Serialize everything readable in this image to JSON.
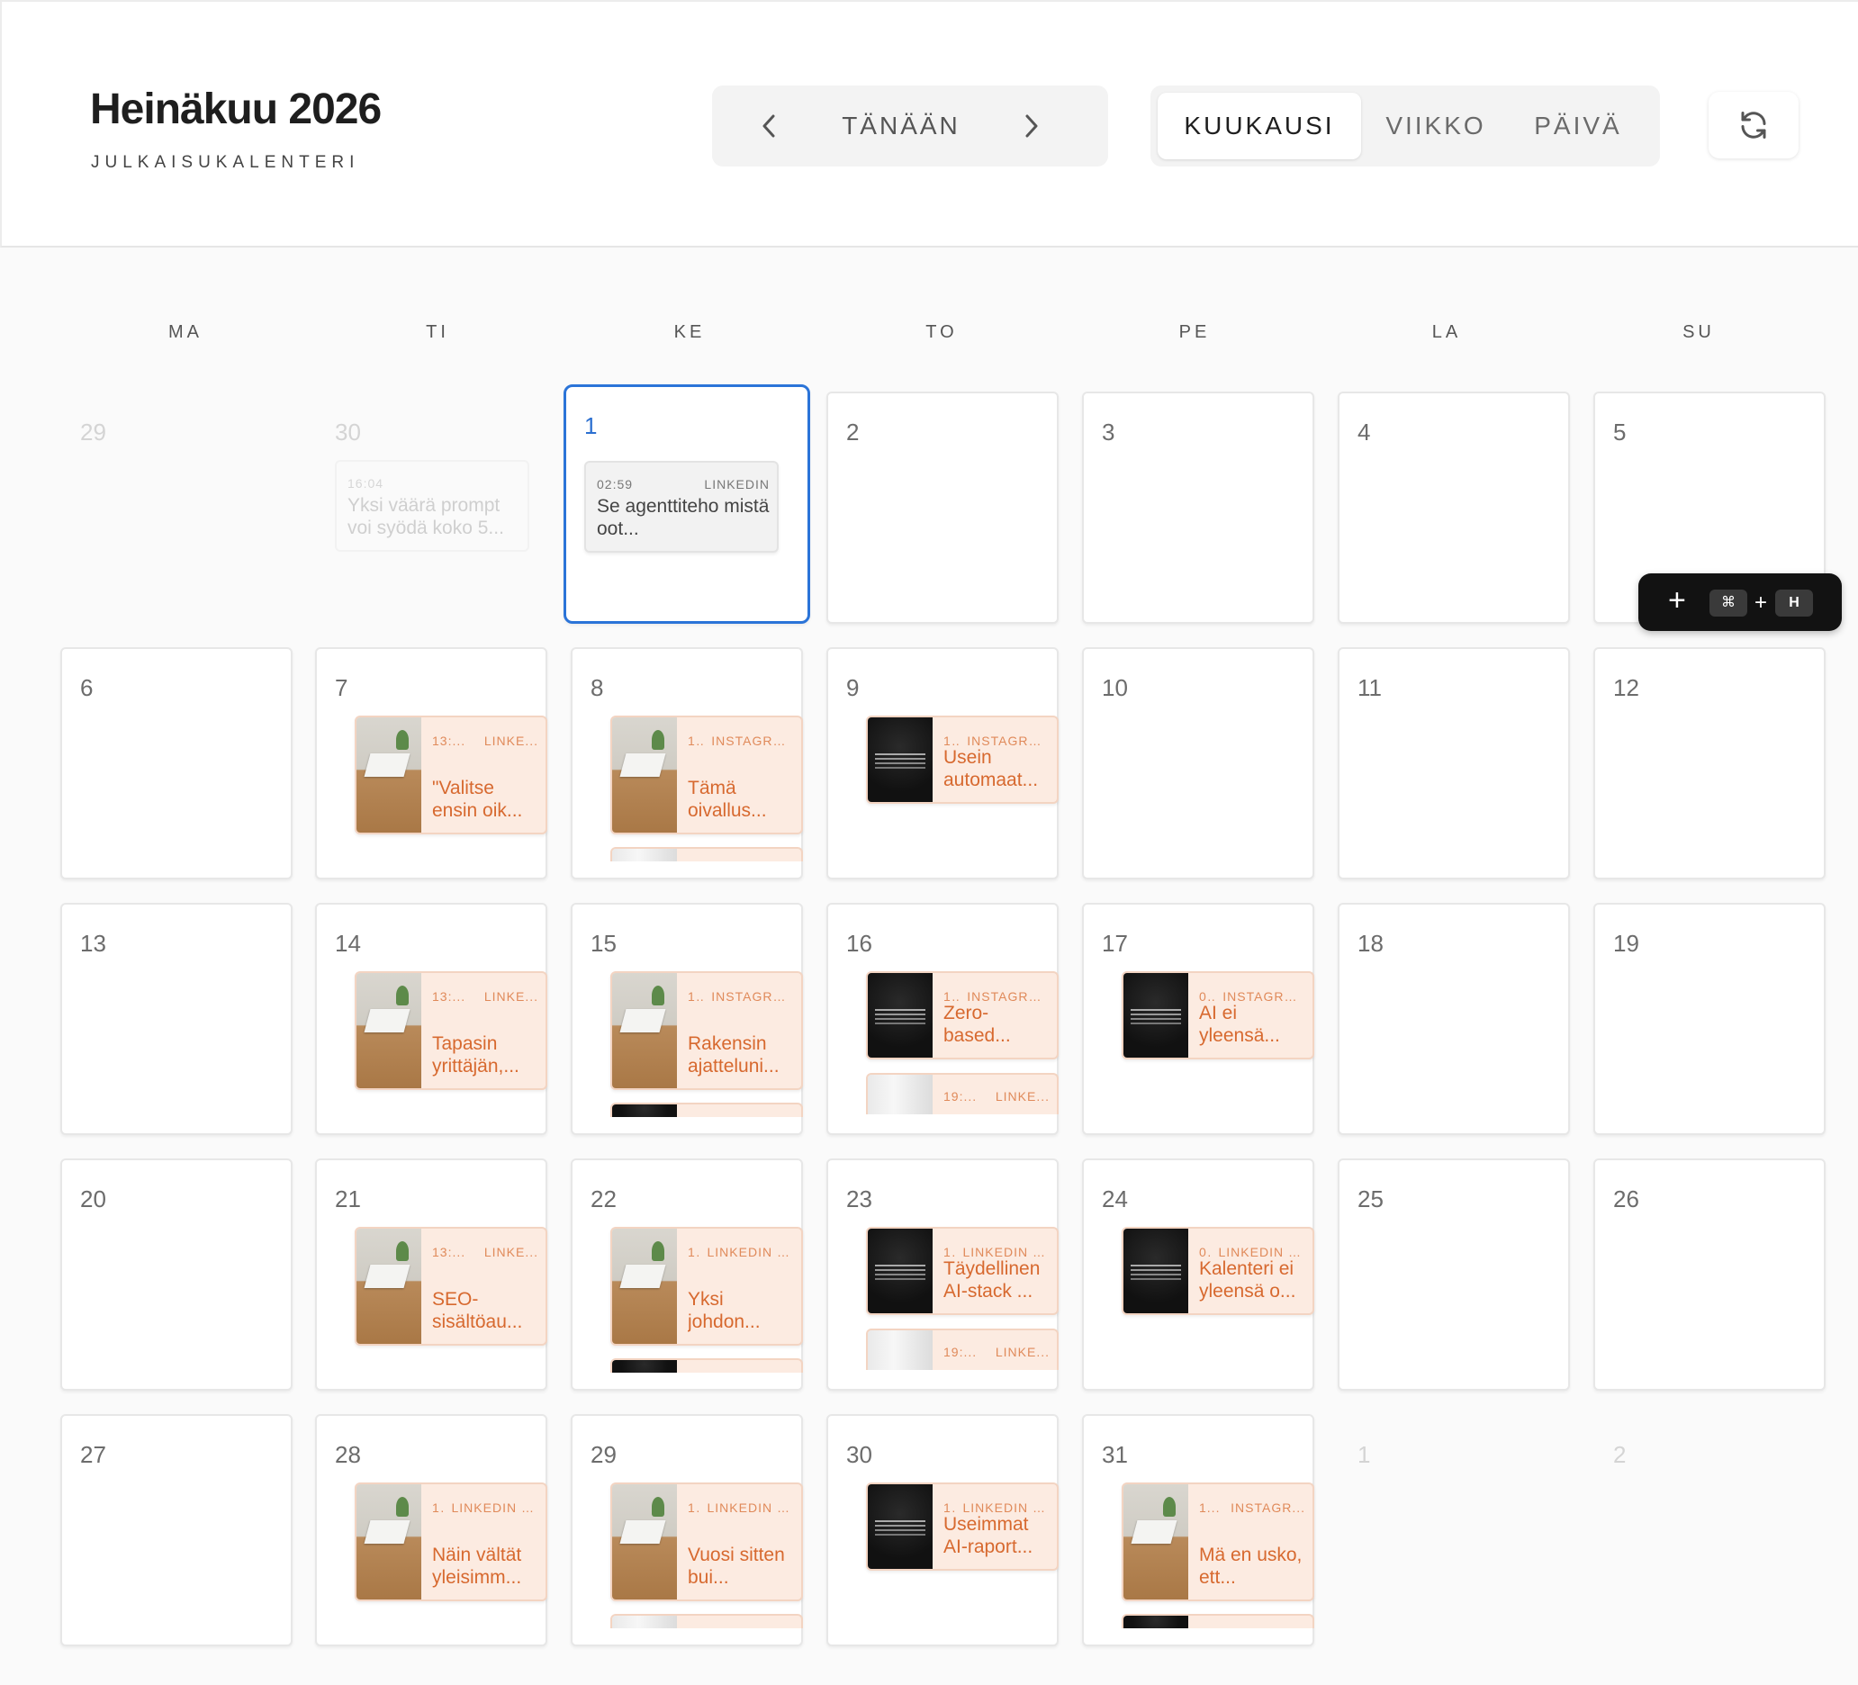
{
  "header": {
    "title": "Heinäkuu 2026",
    "subtitle": "JULKAISUKALENTERI",
    "today_label": "TÄNÄÄN",
    "prev_icon": "chevron-left-icon",
    "next_icon": "chevron-right-icon",
    "refresh_icon": "refresh-icon"
  },
  "views": {
    "month": "KUUKAUSI",
    "week": "VIIKKO",
    "day": "PÄIVÄ",
    "active": "month"
  },
  "weekdays": [
    "MA",
    "TI",
    "KE",
    "TO",
    "PE",
    "LA",
    "SU"
  ],
  "colors": {
    "accent": "#2b74d8",
    "event_bg": "#fcebe1",
    "event_text": "#d7692f",
    "event_meta": "#e08a5a"
  },
  "weeks": [
    [
      {
        "day": "29",
        "muted": true,
        "events": []
      },
      {
        "day": "30",
        "muted": true,
        "events": [
          {
            "time": "16:04",
            "network": "",
            "title": "Yksi väärä prompt voi syödä koko 5...",
            "style": "faded"
          }
        ]
      },
      {
        "day": "1",
        "today": true,
        "events": [
          {
            "time": "02:59",
            "network": "LINKEDIN",
            "title": "Se agenttiteho mistä oot...",
            "style": "grey"
          }
        ]
      },
      {
        "day": "2",
        "events": []
      },
      {
        "day": "3",
        "events": []
      },
      {
        "day": "4",
        "events": []
      },
      {
        "day": "5",
        "events": []
      }
    ],
    [
      {
        "day": "6",
        "events": []
      },
      {
        "day": "7",
        "events": [
          {
            "time": "13:...",
            "network": "LINKE...",
            "title": "\"Valitse ensin oik...",
            "thumb": "desk"
          }
        ]
      },
      {
        "day": "8",
        "events": [
          {
            "time": "1..",
            "network": "INSTAGRA...",
            "title": "Tämä oivallus...",
            "thumb": "desk"
          },
          {
            "style": "stub",
            "thumb": "light"
          }
        ]
      },
      {
        "day": "9",
        "events": [
          {
            "time": "1..",
            "network": "INSTAGRA...",
            "title": "Usein automaat...",
            "thumb": "dark",
            "short": true
          }
        ]
      },
      {
        "day": "10",
        "events": []
      },
      {
        "day": "11",
        "events": []
      },
      {
        "day": "12",
        "events": []
      }
    ],
    [
      {
        "day": "13",
        "events": []
      },
      {
        "day": "14",
        "events": [
          {
            "time": "13:...",
            "network": "LINKE...",
            "title": "Tapasin yrittäjän,...",
            "thumb": "desk"
          }
        ]
      },
      {
        "day": "15",
        "events": [
          {
            "time": "1..",
            "network": "INSTAGRA...",
            "title": "Rakensin ajatteluni...",
            "thumb": "desk"
          },
          {
            "style": "stub",
            "thumb": "dark"
          }
        ]
      },
      {
        "day": "16",
        "events": [
          {
            "time": "1..",
            "network": "INSTAGRA...",
            "title": "Zero-based...",
            "thumb": "dark",
            "short": true
          },
          {
            "style": "stub2",
            "time": "19:...",
            "network": "LINKE...",
            "thumb": "light"
          }
        ]
      },
      {
        "day": "17",
        "events": [
          {
            "time": "0..",
            "network": "INSTAGRA...",
            "title": "AI ei yleensä...",
            "thumb": "dark",
            "short": true
          }
        ]
      },
      {
        "day": "18",
        "events": []
      },
      {
        "day": "19",
        "events": []
      }
    ],
    [
      {
        "day": "20",
        "events": []
      },
      {
        "day": "21",
        "events": [
          {
            "time": "13:...",
            "network": "LINKE...",
            "title": "SEO-sisältöau...",
            "thumb": "desk"
          }
        ]
      },
      {
        "day": "22",
        "events": [
          {
            "time": "1.",
            "network": "LINKEDIN -...",
            "title": "Yksi johdon...",
            "thumb": "desk"
          },
          {
            "style": "stub",
            "thumb": "dark"
          }
        ]
      },
      {
        "day": "23",
        "events": [
          {
            "time": "1.",
            "network": "LINKEDIN -...",
            "title": "Täydellinen AI-stack ...",
            "thumb": "dark",
            "short": true
          },
          {
            "style": "stub2",
            "time": "19:...",
            "network": "LINKE...",
            "thumb": "light"
          }
        ]
      },
      {
        "day": "24",
        "events": [
          {
            "time": "0.",
            "network": "LINKEDIN -...",
            "title": "Kalenteri ei yleensä o...",
            "thumb": "dark",
            "short": true
          }
        ]
      },
      {
        "day": "25",
        "events": []
      },
      {
        "day": "26",
        "events": []
      }
    ],
    [
      {
        "day": "27",
        "events": []
      },
      {
        "day": "28",
        "events": [
          {
            "time": "1.",
            "network": "LINKEDIN -...",
            "title": "Näin vältät yleisimm...",
            "thumb": "desk"
          }
        ]
      },
      {
        "day": "29",
        "events": [
          {
            "time": "1.",
            "network": "LINKEDIN -...",
            "title": "Vuosi sitten bui...",
            "thumb": "desk"
          },
          {
            "style": "stub",
            "thumb": "light"
          }
        ]
      },
      {
        "day": "30",
        "events": [
          {
            "time": "1.",
            "network": "LINKEDIN -...",
            "title": "Useimmat AI-raport...",
            "thumb": "dark",
            "short": true
          }
        ]
      },
      {
        "day": "31",
        "events": [
          {
            "time": "1...",
            "network": "INSTAGR...",
            "title": "Mä en usko, ett...",
            "thumb": "desk"
          },
          {
            "style": "stub",
            "thumb": "dark"
          }
        ]
      },
      {
        "day": "1",
        "muted": true,
        "events": []
      },
      {
        "day": "2",
        "muted": true,
        "events": []
      }
    ]
  ],
  "shortcut": {
    "plus": "+",
    "key1": "⌘",
    "separator": "+",
    "key2": "H"
  }
}
